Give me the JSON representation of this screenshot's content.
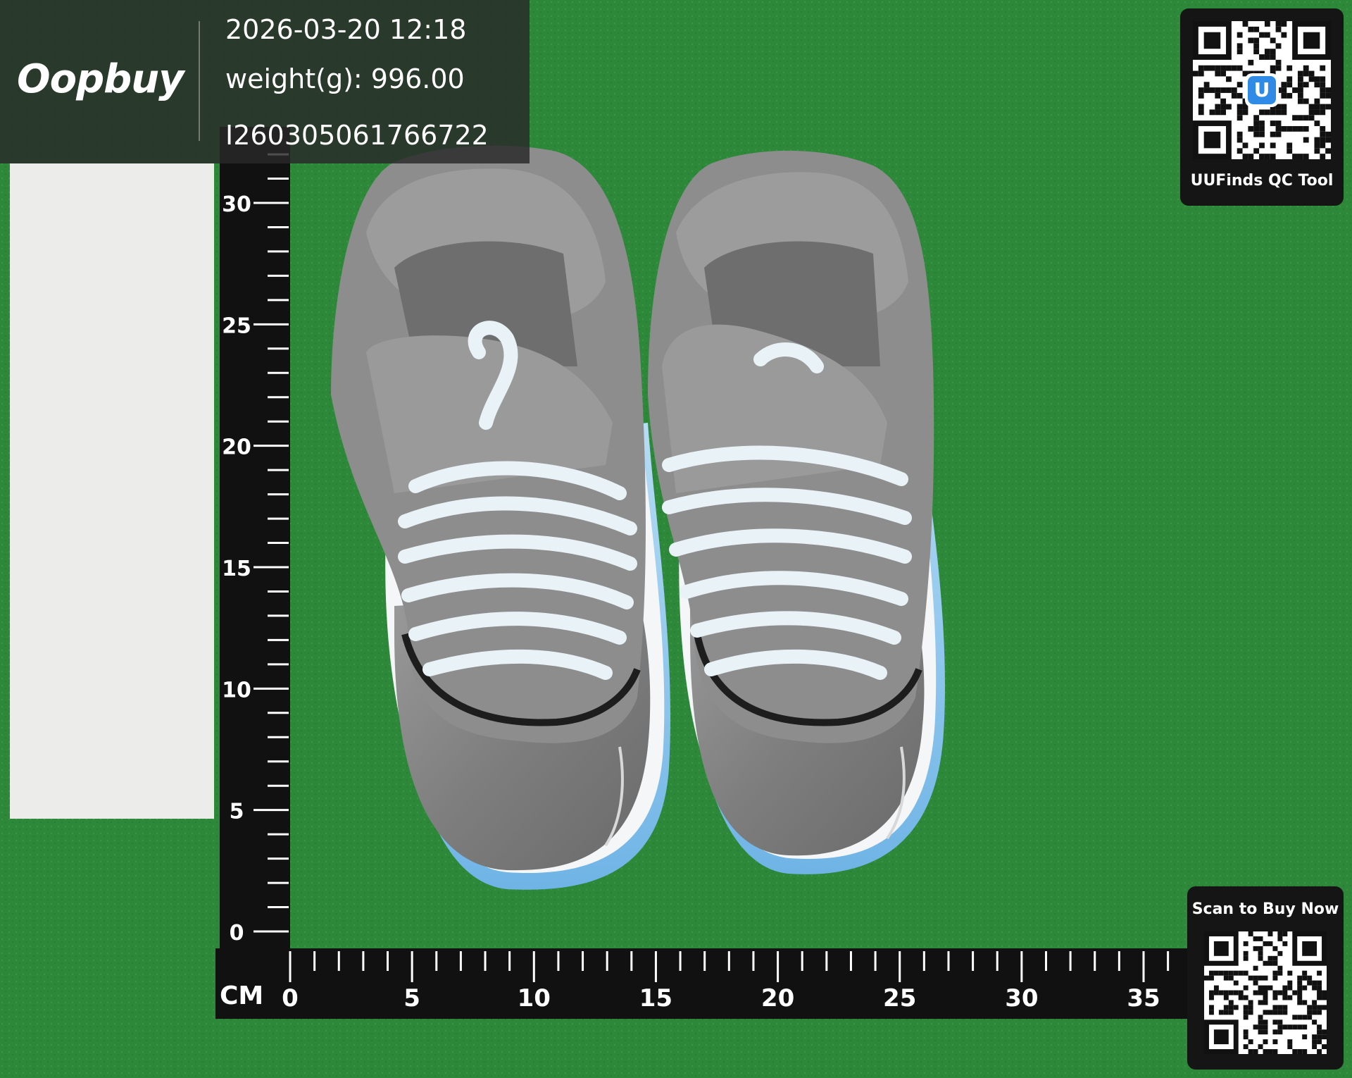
{
  "header": {
    "brand": "Oopbuy",
    "timestamp": "2026-03-20 12:18",
    "weight": "weight(g): 996.00",
    "item_id": "I260305061766722"
  },
  "qc_badge": {
    "label": "UUFinds QC Tool",
    "logo_letter": "U"
  },
  "buy_badge": {
    "label": "Scan to Buy Now"
  },
  "ruler": {
    "unit": "CM",
    "horizontal_labels": [
      "0",
      "5",
      "10",
      "15",
      "20",
      "25",
      "30",
      "35"
    ],
    "vertical_labels": [
      "0",
      "5",
      "10",
      "15",
      "20",
      "25",
      "30"
    ]
  },
  "colors": {
    "mat": "#2f8a3a",
    "shoe_grey": "#8e8e8e",
    "sole_blue": "#8ec7ee",
    "lace": "#e9f3f7"
  }
}
